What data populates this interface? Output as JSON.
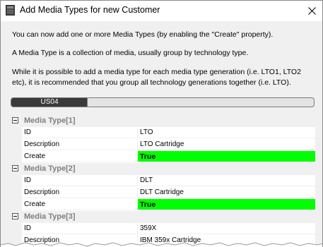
{
  "window": {
    "title": "Add Media Types for new Customer"
  },
  "intro": {
    "line1": "You can now add one or more Media Types (by enabling the \"Create\" property).",
    "line2": "A Media Type is a collection of media, usually group by technology type.",
    "line3a": "While it is possible to add a media type for each media type generation (i.e. LTO1, LTO2",
    "line3b": "etc), it is recommended that you group all technology generations together (i.e. LTO)."
  },
  "progress": {
    "label": "US04",
    "fraction": 0.25
  },
  "colors": {
    "create_true_bg": "#00ff00",
    "category_text": "#808080",
    "progress_fill": "#3a3a3a"
  },
  "grid": {
    "categories": [
      {
        "label": "Media Type[1]",
        "rows": [
          {
            "name": "ID",
            "value": "LTO"
          },
          {
            "name": "Description",
            "value": "LTO Cartridge"
          },
          {
            "name": "Create",
            "value": "True"
          }
        ]
      },
      {
        "label": "Media Type[2]",
        "rows": [
          {
            "name": "ID",
            "value": "DLT"
          },
          {
            "name": "Description",
            "value": "DLT Cartridge"
          },
          {
            "name": "Create",
            "value": "True"
          }
        ]
      },
      {
        "label": "Media Type[3]",
        "rows": [
          {
            "name": "ID",
            "value": "359X"
          },
          {
            "name": "Description",
            "value": "IBM 359x Cartridge"
          }
        ]
      }
    ]
  }
}
